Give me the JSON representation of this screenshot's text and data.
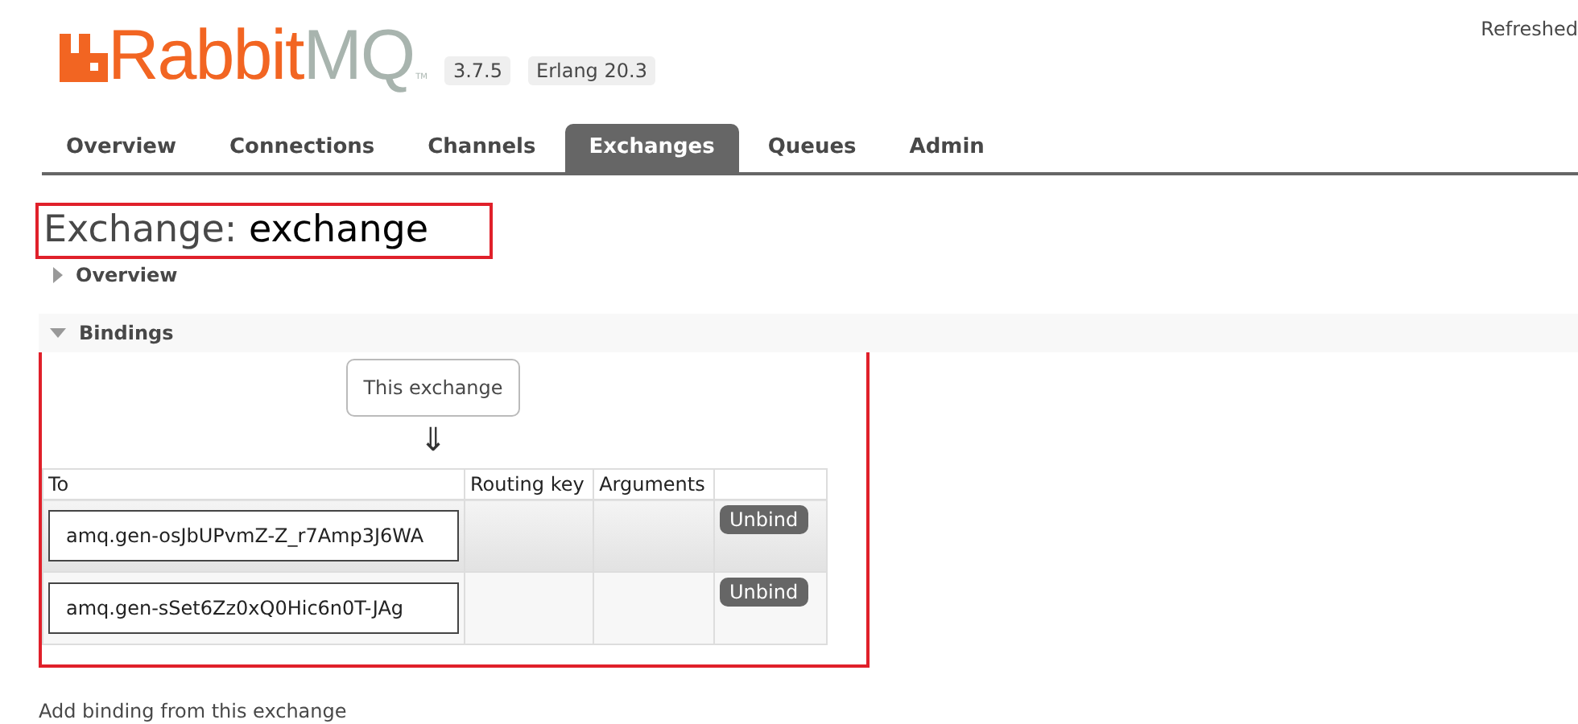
{
  "header": {
    "logo": {
      "text_1": "Rabbit",
      "text_2": "MQ",
      "trademark": "TM"
    },
    "badges": [
      "3.7.5",
      "Erlang 20.3"
    ],
    "refreshed": "Refreshed"
  },
  "tabs": [
    {
      "label": "Overview",
      "selected": false
    },
    {
      "label": "Connections",
      "selected": false
    },
    {
      "label": "Channels",
      "selected": false
    },
    {
      "label": "Exchanges",
      "selected": true
    },
    {
      "label": "Queues",
      "selected": false
    },
    {
      "label": "Admin",
      "selected": false
    }
  ],
  "title": {
    "prefix": "Exchange:",
    "name": "exchange",
    "highlighted": true
  },
  "sections": [
    {
      "label": "Overview",
      "expanded": false,
      "highlighted": false
    },
    {
      "label": "Bindings",
      "expanded": true,
      "highlighted": true,
      "source": "This exchange",
      "arrow": "⇓",
      "table": {
        "columns": [
          "To",
          "Routing key",
          "Arguments"
        ],
        "rows": [
          {
            "to": "amq.gen-osJbUPvmZ-Z_r7Amp3J6WA",
            "action": "Unbind"
          },
          {
            "to": "amq.gen-sSet6Zz0xQ0Hic6n0T-JAg",
            "action": "Unbind"
          }
        ]
      }
    }
  ],
  "footer_link": "Add binding from this exchange"
}
